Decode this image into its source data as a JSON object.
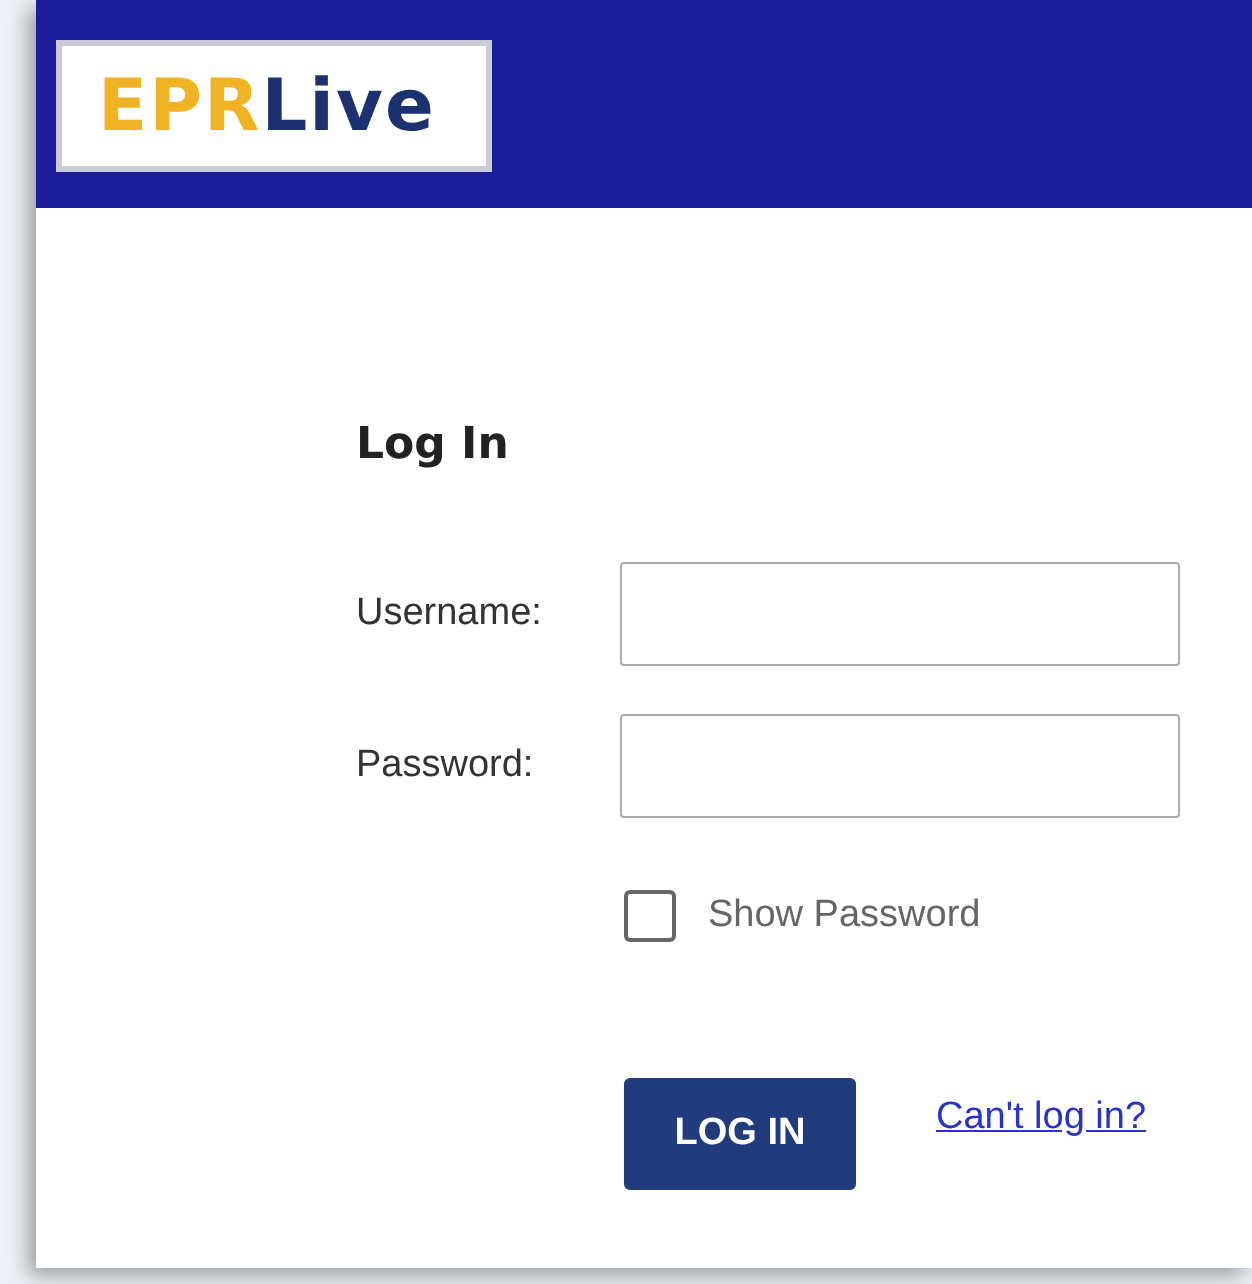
{
  "header": {
    "logo": {
      "part_1": "EPR",
      "part_2": "Live"
    }
  },
  "form": {
    "title": "Log In",
    "fields": [
      {
        "label": "Username:"
      },
      {
        "label": "Password:"
      }
    ],
    "show_password": {
      "label": "Show Password",
      "checked": false
    },
    "submit": "LOG IN",
    "help_link": "Can't log in?"
  }
}
